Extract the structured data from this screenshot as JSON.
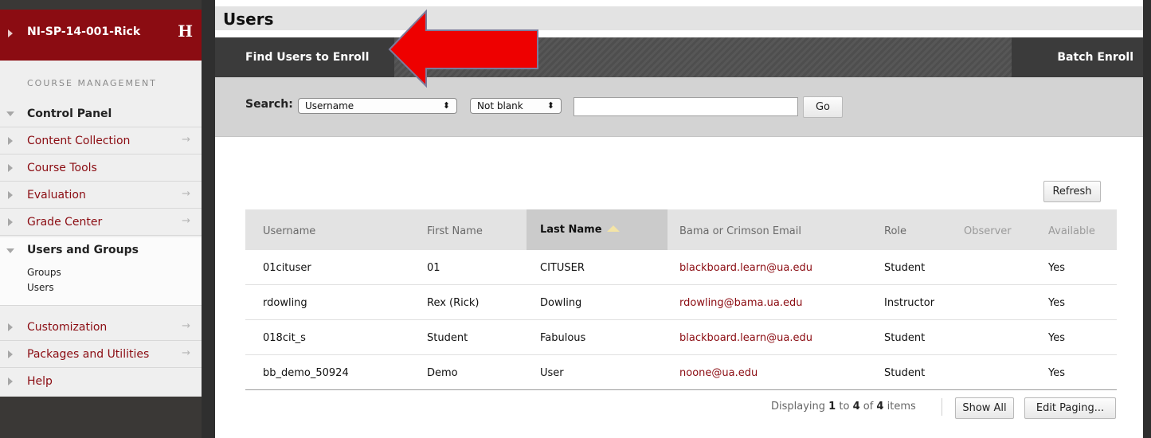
{
  "sidebar": {
    "course_title": "NI-SP-14-001-Rick",
    "logo_letter": "H",
    "section_label": "COURSE MANAGEMENT",
    "items": [
      {
        "label": "Control Panel"
      },
      {
        "label": "Content Collection"
      },
      {
        "label": "Course Tools"
      },
      {
        "label": "Evaluation"
      },
      {
        "label": "Grade Center"
      },
      {
        "label": "Users and Groups"
      },
      {
        "label": "Customization"
      },
      {
        "label": "Packages and Utilities"
      },
      {
        "label": "Help"
      }
    ],
    "sub_items": [
      "Groups",
      "Users"
    ],
    "arrow_glyph": "→"
  },
  "page": {
    "title": "Users",
    "find_users_button": "Find Users to Enroll",
    "batch_enroll_button": "Batch Enroll Users"
  },
  "search": {
    "label": "Search:",
    "field_select": "Username",
    "condition_select": "Not blank",
    "query_value": "",
    "go_button": "Go",
    "chevron": "⬍"
  },
  "table": {
    "refresh_button": "Refresh",
    "headers": [
      "Username",
      "First Name",
      "Last Name",
      "Bama or Crimson Email",
      "Role",
      "Observer",
      "Available"
    ],
    "sorted_column": "Last Name",
    "rows": [
      [
        "01cituser",
        "01",
        "CITUSER",
        "blackboard.learn@ua.edu",
        "Student",
        "",
        "Yes"
      ],
      [
        "rdowling",
        "Rex (Rick)",
        "Dowling",
        "rdowling@bama.ua.edu",
        "Instructor",
        "",
        "Yes"
      ],
      [
        "018cit_s",
        "Student",
        "Fabulous",
        "blackboard.learn@ua.edu",
        "Student",
        "",
        "Yes"
      ],
      [
        "bb_demo_50924",
        "Demo",
        "User",
        "noone@ua.edu",
        "Student",
        "",
        "Yes"
      ]
    ]
  },
  "paging": {
    "prefix": "Displaying",
    "from": "1",
    "to_word": "to",
    "to": "4",
    "of_word": "of",
    "total": "4",
    "suffix": "items",
    "show_all_button": "Show All",
    "edit_paging_button": "Edit Paging..."
  },
  "colors": {
    "brand_red": "#8b0c12",
    "annotation_arrow": "#ee0000"
  }
}
